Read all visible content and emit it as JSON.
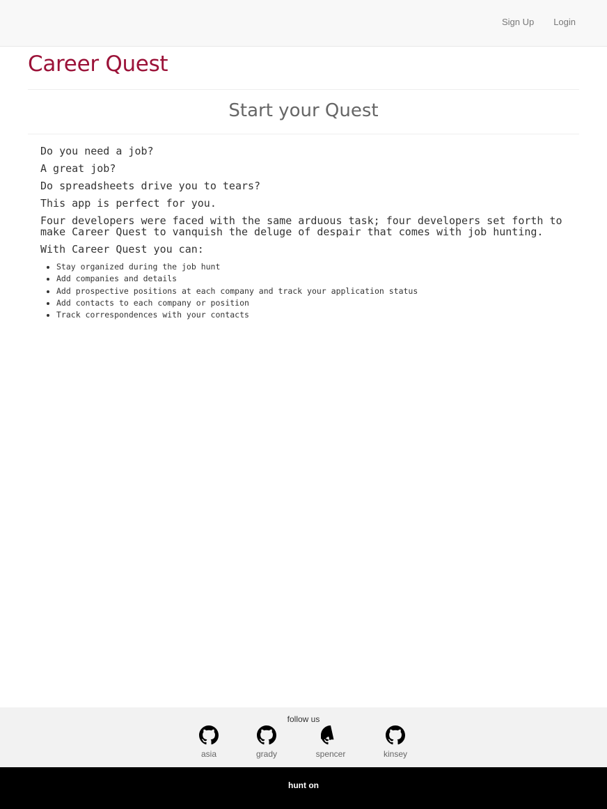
{
  "nav": {
    "signup_label": "Sign Up",
    "login_label": "Login"
  },
  "brand": {
    "title": "Career Quest",
    "color": "#9b1238"
  },
  "main": {
    "heading": "Start your Quest",
    "paragraphs": [
      "Do you need a job?",
      "A great job?",
      "Do spreadsheets drive you to tears?",
      "This app is perfect for you.",
      "Four developers were faced with the same arduous task; four developers set forth to make Career Quest to vanquish the deluge of despair that comes with job hunting.",
      "With Career Quest you can:"
    ],
    "features": [
      "Stay organized during the job hunt",
      "Add companies and details",
      "Add prospective positions at each company and track your application status",
      "Add contacts to each company or position",
      "Track correspondences with your contacts"
    ]
  },
  "footer": {
    "follow_label": "follow us",
    "links": [
      {
        "name": "asia",
        "icon": "github-icon"
      },
      {
        "name": "grady",
        "icon": "github-icon"
      },
      {
        "name": "spencer",
        "icon": "github-icon"
      },
      {
        "name": "kinsey",
        "icon": "github-icon"
      }
    ],
    "tagline": "hunt on"
  }
}
